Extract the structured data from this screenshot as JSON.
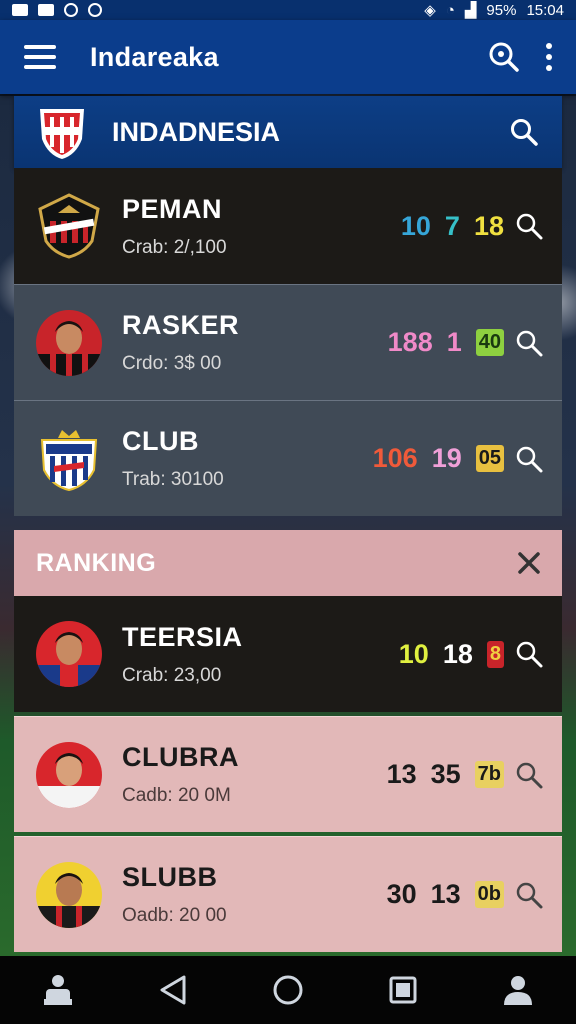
{
  "status_bar": {
    "battery": "95%",
    "time": "15:04"
  },
  "app_bar": {
    "title": "Indareaka"
  },
  "section": {
    "title": "INDADNESIA"
  },
  "rows": [
    {
      "name": "PEMAN",
      "sub": "Crab:  2/,100",
      "stats": [
        "10",
        "7",
        "18"
      ],
      "stat_colors": [
        "#36a6d8",
        "#36c0c8",
        "#f0e040"
      ]
    },
    {
      "name": "RASKER",
      "sub": "Crdo: 3$ 00",
      "stats": [
        "188",
        "1",
        "40"
      ],
      "stat_colors": [
        "#f08ac8",
        "#f08ac8",
        "#1a3a10"
      ]
    },
    {
      "name": "CLUB",
      "sub": "Trab:  30100",
      "stats": [
        "106",
        "19",
        "05"
      ],
      "stat_colors": [
        "#f05a3a",
        "#f0a0d8",
        "#1a1a1a"
      ]
    }
  ],
  "ranking": {
    "title": "RANKING",
    "rows": [
      {
        "name": "TEERSIA",
        "sub": "Crab: 23,00",
        "stats": [
          "10",
          "18",
          "8"
        ],
        "stat_colors": [
          "#e0f040",
          "#ffffff",
          "#f0d040"
        ]
      },
      {
        "name": "CLUBRA",
        "sub": "Cadb: 20 0M",
        "stats": [
          "13",
          "35",
          "7b"
        ],
        "stat_colors": [
          "#1a1a1a",
          "#1a1a1a",
          "#1a1a1a"
        ]
      },
      {
        "name": "SLUBB",
        "sub": "Oadb: 20 00",
        "stats": [
          "30",
          "13",
          "0b"
        ],
        "stat_colors": [
          "#1a1a1a",
          "#1a1a1a",
          "#1a1a1a"
        ]
      }
    ]
  },
  "icons": {
    "menu": "hamburger-icon",
    "search": "search-icon",
    "more": "more-vert-icon",
    "close": "close-icon",
    "nav": [
      "home-icon",
      "back-icon",
      "home-circle-icon",
      "recents-icon",
      "profile-icon"
    ]
  },
  "colors": {
    "app_bar": "#0b3d8c",
    "ranking_header": "#d9a8ac",
    "row_pink": "#e2b8b8"
  }
}
